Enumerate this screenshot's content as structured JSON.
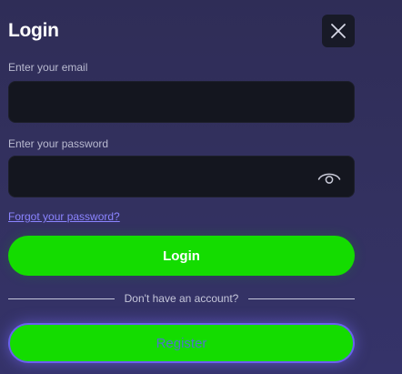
{
  "modal": {
    "title": "Login",
    "close_icon": "close-icon"
  },
  "form": {
    "email_label": "Enter your email",
    "email_value": "",
    "email_placeholder": "",
    "password_label": "Enter your password",
    "password_value": "",
    "password_placeholder": "",
    "eye_icon": "eye-icon",
    "forgot_link": "Forgot your password?",
    "login_label": "Login",
    "divider_text": "Don't have an account?",
    "register_label": "Register"
  },
  "colors": {
    "background": "#2f2d57",
    "field_bg": "#14161f",
    "accent_green": "#14dc00",
    "link": "#8b84ff",
    "register_border": "#6a5ff0"
  }
}
